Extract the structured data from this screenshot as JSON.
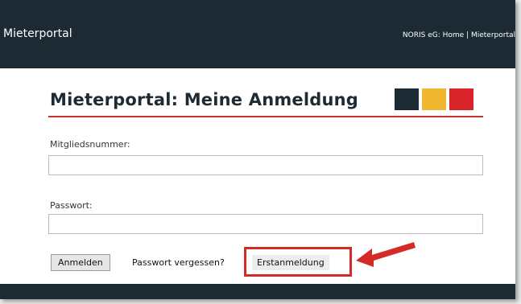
{
  "header": {
    "brand": "Mieterportal",
    "nav": "NORIS eG: Home | Mieterportal"
  },
  "page": {
    "title": "Mieterportal: Meine Anmeldung",
    "colors": [
      "#1c2b33",
      "#f2b731",
      "#d9232a"
    ]
  },
  "form": {
    "member_label": "Mitgliedsnummer:",
    "member_value": "",
    "password_label": "Passwort:",
    "password_value": ""
  },
  "actions": {
    "login": "Anmelden",
    "forgot": "Passwort vergessen?",
    "first_login": "Erstanmeldung"
  }
}
